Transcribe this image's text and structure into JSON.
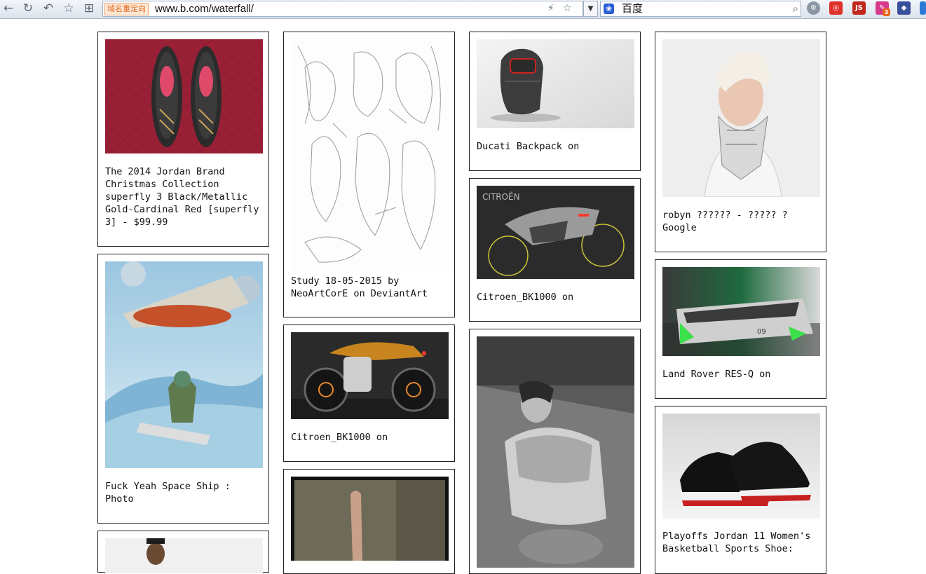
{
  "browser": {
    "address_tag": "域名重定向",
    "url": "www.b.com/waterfall/",
    "search_engine": "百度",
    "extension_js_label": "JS",
    "extension_badge": "3"
  },
  "cards": [
    {
      "caption": "The 2014 Jordan Brand\nChristmas Collection\nsuperfly 3 Black/Metallic\nGold-Cardinal Red [superfly\n3] - $99.99"
    },
    {
      "caption": "Fuck Yeah Space Ship :\nPhoto"
    },
    {
      "caption": ""
    },
    {
      "caption": "Study 18-05-2015 by\nNeoArtCorE on DeviantArt"
    },
    {
      "caption": "Citroen_BK1000 on"
    },
    {
      "caption": ""
    },
    {
      "caption": "Ducati Backpack on"
    },
    {
      "caption": "Citroen_BK1000 on"
    },
    {
      "caption": ""
    },
    {
      "caption": "robyn ?????? - ????? ?\nGoogle"
    },
    {
      "caption": "Land Rover RES-Q on"
    },
    {
      "caption": "Playoffs Jordan 11 Women's\nBasketball Sports Shoe:"
    }
  ]
}
